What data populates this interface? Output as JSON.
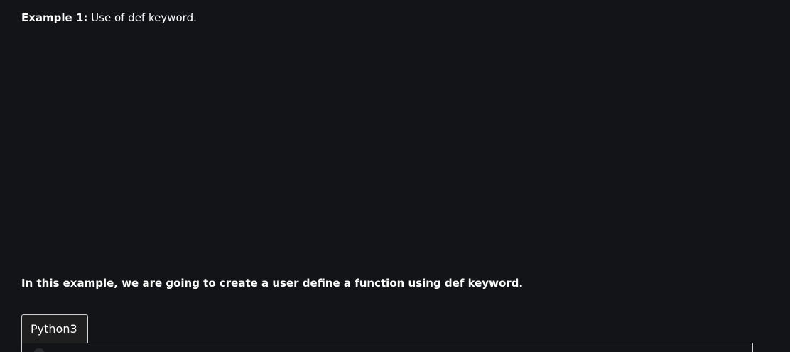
{
  "example": {
    "label": "Example 1:",
    "text": " Use of def keyword."
  },
  "description": "In this example, we are going to create a user define a function using def keyword.",
  "code_tabs": [
    {
      "label": "Python3",
      "active": true
    }
  ]
}
